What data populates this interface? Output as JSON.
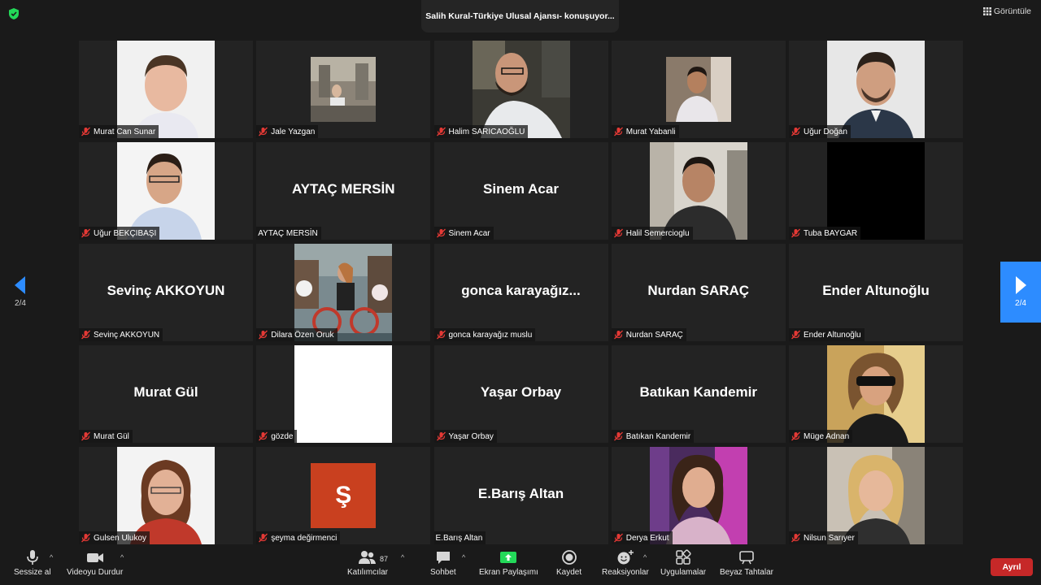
{
  "meeting": {
    "speaking_indicator": "Salih Kural-Türkiye Ulusal Ajansı- konuşuyor...",
    "view_label": "Görüntüle"
  },
  "pagination": {
    "left_page": "2/4",
    "right_page": "2/4"
  },
  "participants": [
    {
      "name": "Murat Can Sunar",
      "display": "photo"
    },
    {
      "name": "Jale Yazgan",
      "display": "photo-small"
    },
    {
      "name": "Halim SARICAOĞLU",
      "display": "photo"
    },
    {
      "name": "Murat Yabanli",
      "display": "photo-small"
    },
    {
      "name": "Uğur Doğan",
      "display": "photo"
    },
    {
      "name": "Uğur BEKÇIBAŞI",
      "display": "photo"
    },
    {
      "name": "AYTAÇ MERSİN",
      "display": "name",
      "big_name": "AYTAÇ MERSİN"
    },
    {
      "name": "Sinem Acar",
      "display": "name",
      "big_name": "Sinem Acar"
    },
    {
      "name": "Halil Semercioglu",
      "display": "photo"
    },
    {
      "name": "Tuba BAYGAR",
      "display": "black"
    },
    {
      "name": "Sevinç AKKOYUN",
      "display": "name",
      "big_name": "Sevinç AKKOYUN"
    },
    {
      "name": "Dilara Özen Oruk",
      "display": "photo"
    },
    {
      "name": "gonca karayağız muslu",
      "display": "name",
      "big_name": "gonca  karayağız..."
    },
    {
      "name": "Nurdan SARAÇ",
      "display": "name",
      "big_name": "Nurdan SARAÇ"
    },
    {
      "name": "Ender Altunoğlu",
      "display": "name",
      "big_name": "Ender Altunoğlu"
    },
    {
      "name": "Murat Gül",
      "display": "name",
      "big_name": "Murat Gül"
    },
    {
      "name": "gözde",
      "display": "white"
    },
    {
      "name": "Yaşar Orbay",
      "display": "name",
      "big_name": "Yaşar Orbay"
    },
    {
      "name": "Batıkan Kandemir",
      "display": "name",
      "big_name": "Batıkan Kandemir"
    },
    {
      "name": "Müge Adnan",
      "display": "photo"
    },
    {
      "name": "Gulsen Ulukoy",
      "display": "photo"
    },
    {
      "name": "şeyma değirmenci",
      "display": "letter",
      "letter": "Ş"
    },
    {
      "name": "E.Barış Altan",
      "display": "name-nomic",
      "big_name": "E.Barış Altan"
    },
    {
      "name": "Derya Erkut",
      "display": "photo"
    },
    {
      "name": "Nilsun Sarıyer",
      "display": "photo"
    }
  ],
  "toolbar": {
    "mute_label": "Sessize al",
    "video_label": "Videoyu Durdur",
    "participants_label": "Katılımcılar",
    "participants_count": "87",
    "chat_label": "Sohbet",
    "share_label": "Ekran Paylaşımı",
    "record_label": "Kaydet",
    "reactions_label": "Reaksiyonlar",
    "apps_label": "Uygulamalar",
    "whiteboard_label": "Beyaz Tahtalar",
    "leave_label": "Ayrıl"
  },
  "colors": {
    "share_green": "#23d959",
    "nav_blue": "#2d8cff",
    "leave_red": "#c62828",
    "muted_red": "#e53935"
  }
}
